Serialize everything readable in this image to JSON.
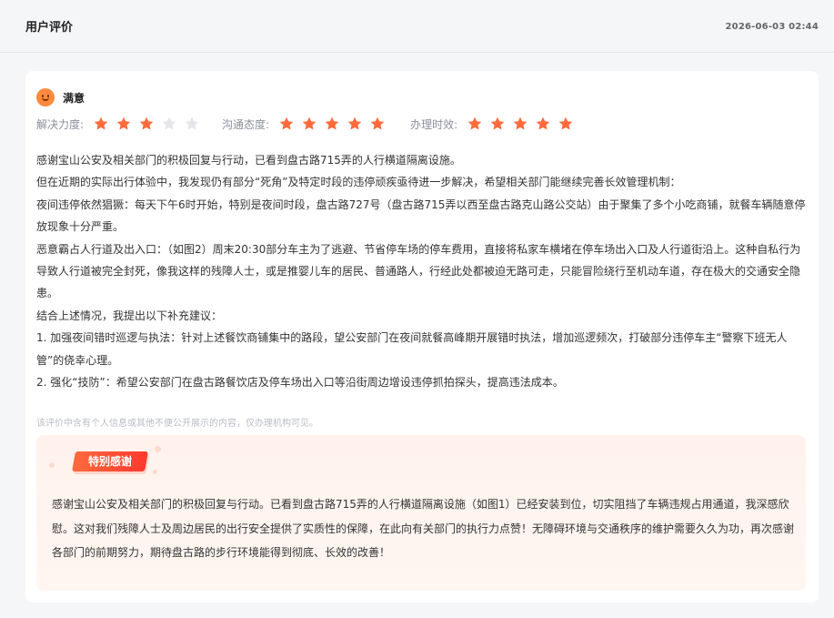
{
  "header": {
    "title": "用户评价",
    "timestamp": "2026-06-03 02:44"
  },
  "review": {
    "rating_label": "满意",
    "rating_icon": "smiley-face-icon",
    "scores": [
      {
        "label": "解决力度:",
        "value": 3,
        "max": 5
      },
      {
        "label": "沟通态度:",
        "value": 5,
        "max": 5
      },
      {
        "label": "办理时效:",
        "value": 5,
        "max": 5
      }
    ],
    "colors": {
      "star_active": "#ff6b3d",
      "star_inactive": "#e3e5e8",
      "accent": "#ff4a2e"
    },
    "paragraphs": [
      "感谢宝山公安及相关部门的积极回复与行动，已看到盘古路715弄的人行横道隔离设施。",
      "但在近期的实际出行体验中，我发现仍有部分“死角”及特定时段的违停顽疾亟待进一步解决，希望相关部门能继续完善长效管理机制：",
      "夜间违停依然猖獗：每天下午6时开始，特别是夜间时段，盘古路727号（盘古路715弄以西至盘古路克山路公交站）由于聚集了多个小吃商铺，就餐车辆随意停放现象十分严重。",
      "恶意霸占人行道及出入口：（如图2）周末20:30部分车主为了逃避、节省停车场的停车费用，直接将私家车横堵在停车场出入口及人行道街沿上。这种自私行为导致人行道被完全封死，像我这样的残障人士，或是推婴儿车的居民、普通路人，行经此处都被迫无路可走，只能冒险绕行至机动车道，存在极大的交通安全隐患。",
      "结合上述情况，我提出以下补充建议：",
      "1. 加强夜间错时巡逻与执法：针对上述餐饮商铺集中的路段，望公安部门在夜间就餐高峰期开展错时执法，增加巡逻频次，打破部分违停车主“警察下班无人管”的侥幸心理。",
      "2. 强化“技防”：希望公安部门在盘古路餐饮店及停车场出入口等沿街周边增设违停抓拍探头，提高违法成本。"
    ],
    "privacy_note": "该评价中含有个人信息或其他不便公开展示的内容，仅办理机构可见。"
  },
  "special_thanks": {
    "badge": "特别感谢",
    "text": "感谢宝山公安及相关部门的积极回复与行动。已看到盘古路715弄的人行横道隔离设施（如图1）已经安装到位，切实阻挡了车辆违规占用通道，我深感欣慰。这对我们残障人士及周边居民的出行安全提供了实质性的保障，在此向有关部门的执行力点赞！无障碍环境与交通秩序的维护需要久久为功，再次感谢各部门的前期努力，期待盘古路的步行环境能得到彻底、长效的改善！"
  }
}
